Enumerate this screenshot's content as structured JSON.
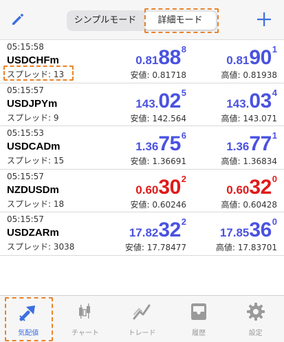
{
  "header": {
    "segments": [
      "シンプルモード",
      "詳細モード"
    ],
    "selected_segment": "詳細モード",
    "edit_icon": "pencil-icon",
    "add_icon": "plus-icon"
  },
  "colors": {
    "accent": "#3d6fe0",
    "bid_blue": "#4a52e0",
    "ask_red": "#e01a1a",
    "highlight": "#e8832a"
  },
  "quotes": [
    {
      "time": "05:15:58",
      "symbol": "USDCHFm",
      "spread": "スプレッド: 13",
      "bid": {
        "small": "0.81",
        "big": "88",
        "sup": "8",
        "color": "blue"
      },
      "ask": {
        "small": "0.81",
        "big": "90",
        "sup": "1",
        "color": "blue"
      },
      "low": "安値: 0.81718",
      "high": "高値: 0.81938"
    },
    {
      "time": "05:15:57",
      "symbol": "USDJPYm",
      "spread": "スプレッド: 9",
      "bid": {
        "small": "143.",
        "big": "02",
        "sup": "5",
        "color": "blue"
      },
      "ask": {
        "small": "143.",
        "big": "03",
        "sup": "4",
        "color": "blue"
      },
      "low": "安値: 142.564",
      "high": "高値: 143.071"
    },
    {
      "time": "05:15:53",
      "symbol": "USDCADm",
      "spread": "スプレッド: 15",
      "bid": {
        "small": "1.36",
        "big": "75",
        "sup": "6",
        "color": "blue"
      },
      "ask": {
        "small": "1.36",
        "big": "77",
        "sup": "1",
        "color": "blue"
      },
      "low": "安値: 1.36691",
      "high": "高値: 1.36834"
    },
    {
      "time": "05:15:57",
      "symbol": "NZDUSDm",
      "spread": "スプレッド: 18",
      "bid": {
        "small": "0.60",
        "big": "30",
        "sup": "2",
        "color": "red"
      },
      "ask": {
        "small": "0.60",
        "big": "32",
        "sup": "0",
        "color": "red"
      },
      "low": "安値: 0.60246",
      "high": "高値: 0.60428"
    },
    {
      "time": "05:15:57",
      "symbol": "USDZARm",
      "spread": "スプレッド: 3038",
      "bid": {
        "small": "17.82",
        "big": "32",
        "sup": "2",
        "color": "blue"
      },
      "ask": {
        "small": "17.85",
        "big": "36",
        "sup": "0",
        "color": "blue"
      },
      "low": "安値: 17.78477",
      "high": "高値: 17.83701"
    }
  ],
  "tabs": [
    {
      "label": "気配値",
      "icon": "quotes-arrow-icon",
      "active": true
    },
    {
      "label": "チャート",
      "icon": "candlestick-icon",
      "active": false
    },
    {
      "label": "トレード",
      "icon": "trade-chart-icon",
      "active": false
    },
    {
      "label": "履歴",
      "icon": "inbox-tray-icon",
      "active": false
    },
    {
      "label": "設定",
      "icon": "gear-icon",
      "active": false
    }
  ]
}
